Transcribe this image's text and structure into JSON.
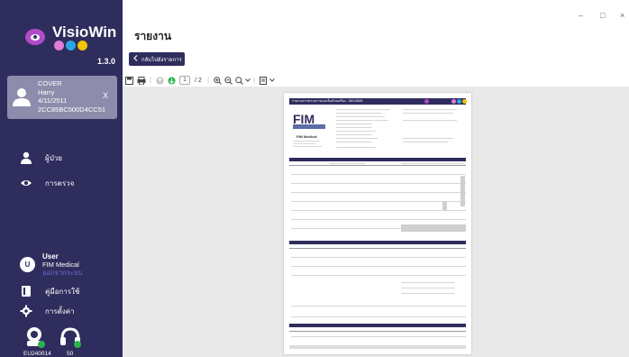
{
  "app": {
    "logo_text": "VisioWin",
    "version": "1.3.0",
    "brand_colors": {
      "sidebar": "#2f2d5d",
      "card": "#8e8cac",
      "accent": "#b04cc7"
    },
    "logo_dot_colors": [
      "#e07bd9",
      "#2aa7e0",
      "#f0c400"
    ]
  },
  "patient": {
    "line1": "COVER",
    "line2": "Harry",
    "line3": "4/11/2511",
    "line4": "2CC85BC500D4CC51",
    "close_label": "X"
  },
  "nav": [
    {
      "icon": "person-icon",
      "label": "ผู้ป่วย"
    },
    {
      "icon": "eye-icon",
      "label": "การตรวจ"
    }
  ],
  "user": {
    "avatar_letter": "U",
    "name": "User",
    "org": "FIM Medical",
    "logout": "ออกจากระบบ"
  },
  "bottom_nav": [
    {
      "icon": "book-icon",
      "label": "คู่มือการใช้"
    },
    {
      "icon": "gear-icon",
      "label": "การตั้งค่า"
    }
  ],
  "devices": [
    {
      "icon": "device-headset-icon",
      "label": "EU240014"
    },
    {
      "icon": "device-headphone-icon",
      "label": "50"
    }
  ],
  "header": {
    "title": "รายงาน",
    "back_label": "กลับไปยังรายการ"
  },
  "window_controls": [
    "–",
    "□",
    "×"
  ],
  "pdf_toolbar": {
    "page_current": "1",
    "page_total": "/ 2"
  },
  "report": {
    "header_text": "รายงานการตรวจการมองเห็นด้วยเครื่อง - 05/1/2568",
    "brand_name": "FIM Medical"
  }
}
